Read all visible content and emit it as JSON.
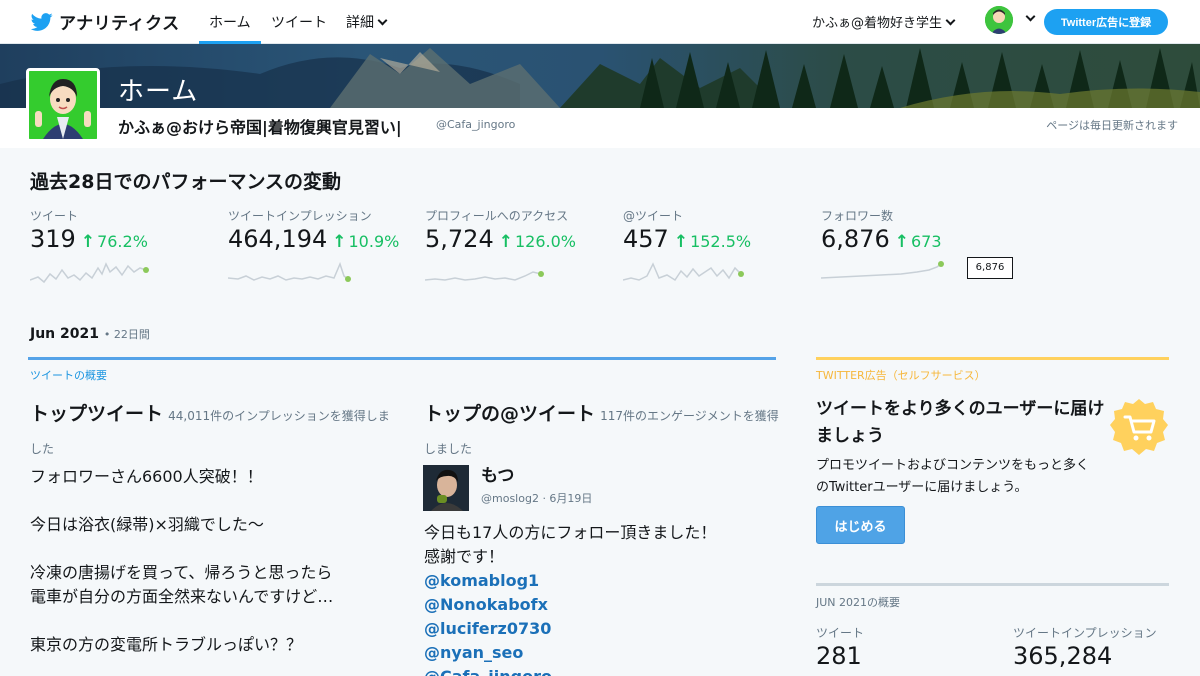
{
  "nav": {
    "brand": "アナリティクス",
    "tabs": {
      "home": "ホーム",
      "tweets": "ツイート",
      "more": "詳細"
    },
    "account": "かふぁ@着物好き学生",
    "ads_button": "Twitter広告に登録"
  },
  "header": {
    "title": "ホーム",
    "display_name": "かふぁ@おけら帝国|着物復興官見習い|",
    "handle": "@Cafa_jingoro",
    "update_note": "ページは毎日更新されます"
  },
  "performance": {
    "title": "過去28日でのパフォーマンスの変動",
    "metrics": [
      {
        "label": "ツイート",
        "value": "319",
        "change": "76.2%"
      },
      {
        "label": "ツイートインプレッション",
        "value": "464,194",
        "change": "10.9%"
      },
      {
        "label": "プロフィールへのアクセス",
        "value": "5,724",
        "change": "126.0%"
      },
      {
        "label": "@ツイート",
        "value": "457",
        "change": "152.5%"
      },
      {
        "label": "フォロワー数",
        "value": "6,876",
        "change": "673"
      }
    ],
    "tooltip": "6,876",
    "accent_color": "#17bf63",
    "arrow_icon": "arrow-up-icon"
  },
  "month": {
    "label": "Jun 2021",
    "days": "• 22日間",
    "section_label": "ツイートの概要"
  },
  "top_tweet": {
    "title": "トップツイート",
    "subtitle": "44,011件のインプレッションを獲得しました",
    "lines": [
      "フォロワーさん6600人突破！！",
      "",
      "今日は浴衣(緑帯)×羽織でした〜",
      "",
      "冷凍の唐揚げを買って、帰ろうと思ったら",
      "電車が自分の方面全然来ないんですけど…",
      "",
      "東京の方の変電所トラブルっぽい？？"
    ]
  },
  "top_mention": {
    "title": "トップの@ツイート",
    "subtitle": "117件のエンゲージメントを獲得しました",
    "name": "もつ",
    "meta": "@moslog2 · 6月19日",
    "lines": [
      "今日も17人の方にフォロー頂きました！",
      "感謝です！"
    ],
    "mentions": [
      "@komablog1",
      "@Nonokabofx",
      "@luciferz0730",
      "@nyan_seo",
      "@Cafa_jingoro"
    ]
  },
  "ads": {
    "label": "TWITTER広告（セルフサービス）",
    "title": "ツイートをより多くのユーザーに届けましょう",
    "text": "プロモツイートおよびコンテンツをもっと多くのTwitterユーザーに届けましょう。",
    "button": "はじめる",
    "icon": "shopping-cart-icon"
  },
  "summary": {
    "label": "JUN 2021の概要",
    "metrics": [
      {
        "label": "ツイート",
        "value": "281"
      },
      {
        "label": "ツイートインプレッション",
        "value": "365,284"
      }
    ]
  },
  "colors": {
    "twitter_blue": "#1da1f2",
    "link_blue": "#1b95e0",
    "ads_yellow": "#ffd15d",
    "positive_green": "#17bf63"
  }
}
